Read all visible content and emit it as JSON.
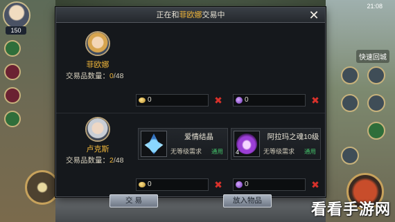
{
  "hud": {
    "level": "150",
    "timer": "21:08",
    "quick_return": "快速回城"
  },
  "dialog": {
    "title_prefix": "正在和",
    "title_partner": "菲欧娜",
    "title_suffix": "交易中",
    "close_icon": "close-icon"
  },
  "partner": {
    "name": "菲欧娜",
    "count_label": "交易品数量：",
    "count_value": "0",
    "count_max": "/48",
    "gold_value": "0",
    "gem_value": "0"
  },
  "self": {
    "name": "卢克斯",
    "count_label": "交易品数量：",
    "count_value": "2",
    "count_max": "/48",
    "gold_value": "0",
    "gem_value": "0",
    "items": [
      {
        "name": "爱情结晶",
        "requirement": "无等级需求",
        "bound": "通用",
        "icon": "blue-crystal-icon",
        "count": ""
      },
      {
        "name": "阿拉玛之魂10级",
        "requirement": "无等级需求",
        "bound": "通用",
        "icon": "purple-soul-icon",
        "count": "4"
      }
    ]
  },
  "buttons": {
    "trade": "交 易",
    "add_item": "放入物品"
  },
  "watermark": "看看手游网",
  "colors": {
    "accent_gold": "#f0b63a",
    "remove_red": "#d8312b",
    "bound_green": "#44c26a",
    "panel_bg": "#15181c"
  }
}
